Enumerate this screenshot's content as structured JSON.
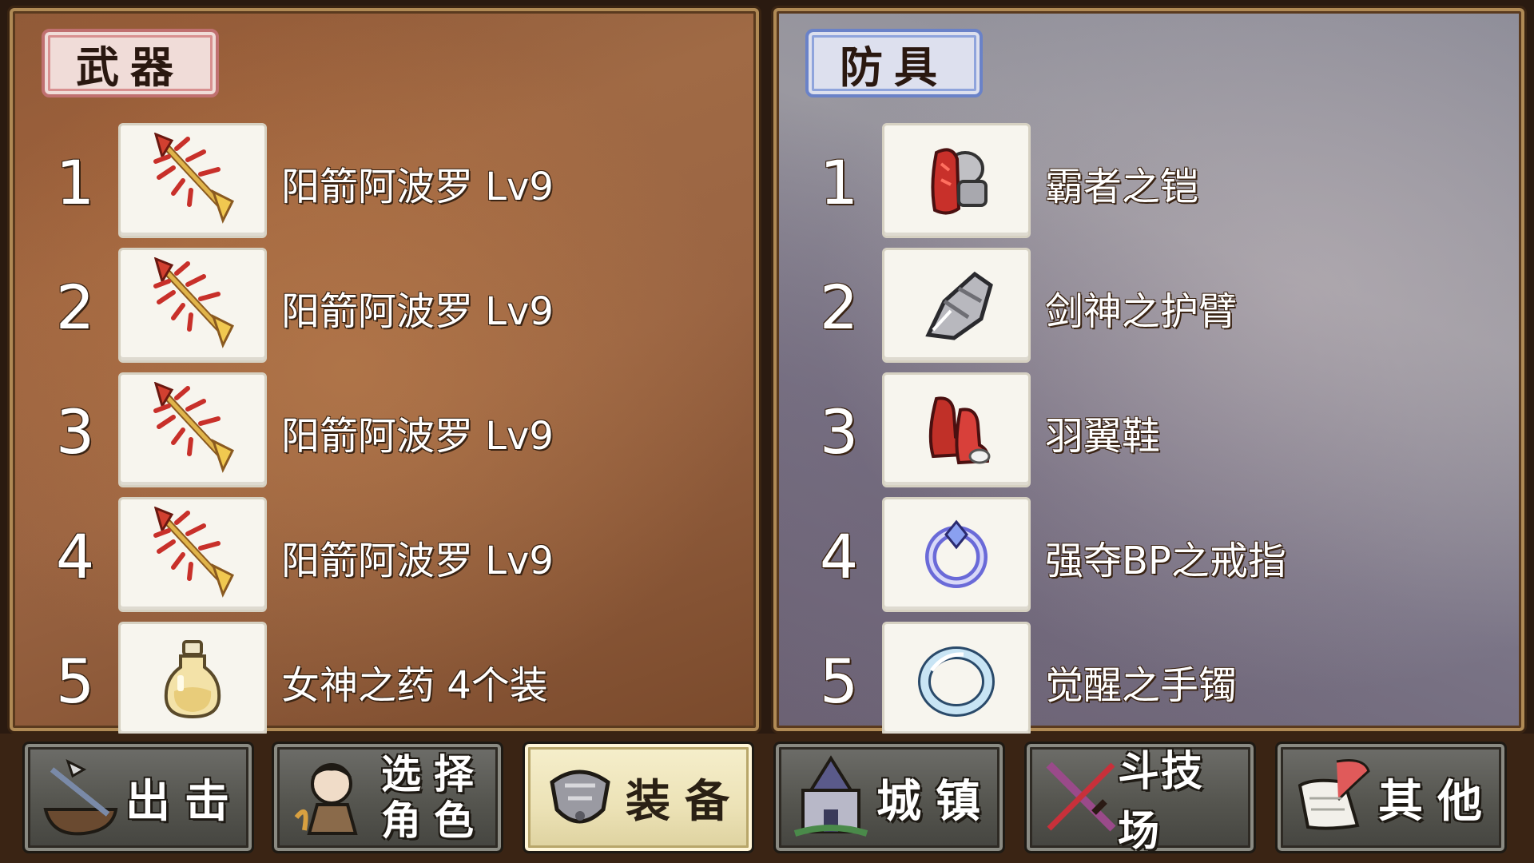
{
  "weapons": {
    "title": "武器",
    "slots": [
      {
        "num": "1",
        "name": "阳箭阿波罗 Lv9",
        "icon": "golden-arrow-icon"
      },
      {
        "num": "2",
        "name": "阳箭阿波罗 Lv9",
        "icon": "golden-arrow-icon"
      },
      {
        "num": "3",
        "name": "阳箭阿波罗 Lv9",
        "icon": "golden-arrow-icon"
      },
      {
        "num": "4",
        "name": "阳箭阿波罗 Lv9",
        "icon": "golden-arrow-icon"
      },
      {
        "num": "5",
        "name": "女神之药 4个装",
        "icon": "potion-bottle-icon"
      }
    ]
  },
  "armor": {
    "title": "防具",
    "slots": [
      {
        "num": "1",
        "name": "霸者之铠",
        "icon": "red-armor-icon"
      },
      {
        "num": "2",
        "name": "剑神之护臂",
        "icon": "gauntlet-icon"
      },
      {
        "num": "3",
        "name": "羽翼鞋",
        "icon": "red-boots-icon"
      },
      {
        "num": "4",
        "name": "强夺BP之戒指",
        "icon": "ring-icon"
      },
      {
        "num": "5",
        "name": "觉醒之手镯",
        "icon": "bracelet-icon"
      }
    ]
  },
  "nav": {
    "sortie": "出击",
    "select_char": "选择\n角色",
    "equip": "装备",
    "town": "城镇",
    "arena": "斗技场",
    "other": "其他",
    "active": "equip"
  },
  "colors": {
    "weapons_panel": "#9a6442",
    "armor_panel": "#8a8896",
    "weapons_tag_border": "#c07070",
    "armor_tag_border": "#6a82c8",
    "active_button": "#ece2b6"
  }
}
